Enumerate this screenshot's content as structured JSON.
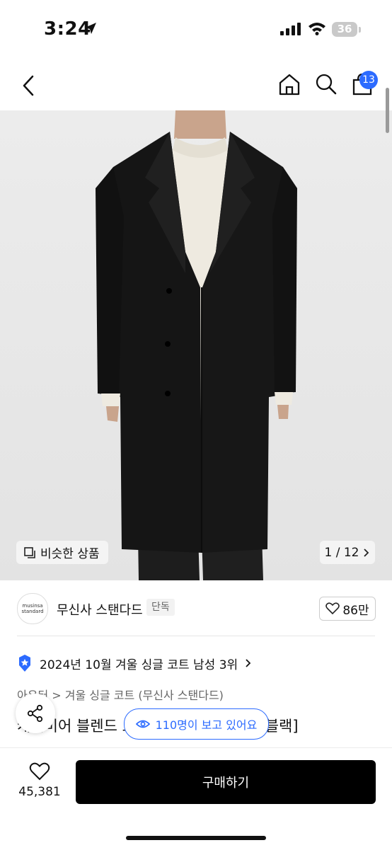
{
  "status": {
    "time": "3:24",
    "battery": "36"
  },
  "nav": {
    "cart_count": "13"
  },
  "hero": {
    "similar_label": "비슷한 상품",
    "counter": "1 / 12"
  },
  "brand": {
    "logo_line1": "musinsa",
    "logo_line2": "standard",
    "name": "무신사 스탠다드",
    "tag": "단독",
    "likes": "86만"
  },
  "ranking": {
    "text": "2024년 10월 겨울 싱글 코트 남성 3위"
  },
  "breadcrumb": {
    "text": "아우터 > 겨울 싱글 코트 (무신사 스탠다드)"
  },
  "product": {
    "title": "캐시미어 블렌드 오버사이즈 싱글 코트 [블랙]"
  },
  "viewers": {
    "text": "110명이 보고 있어요"
  },
  "bottom": {
    "wish_count": "45,381",
    "buy_label": "구매하기"
  },
  "colors": {
    "accent": "#2c6bff",
    "buy_bg": "#000000",
    "hero_bg": "#e7e7e7"
  }
}
